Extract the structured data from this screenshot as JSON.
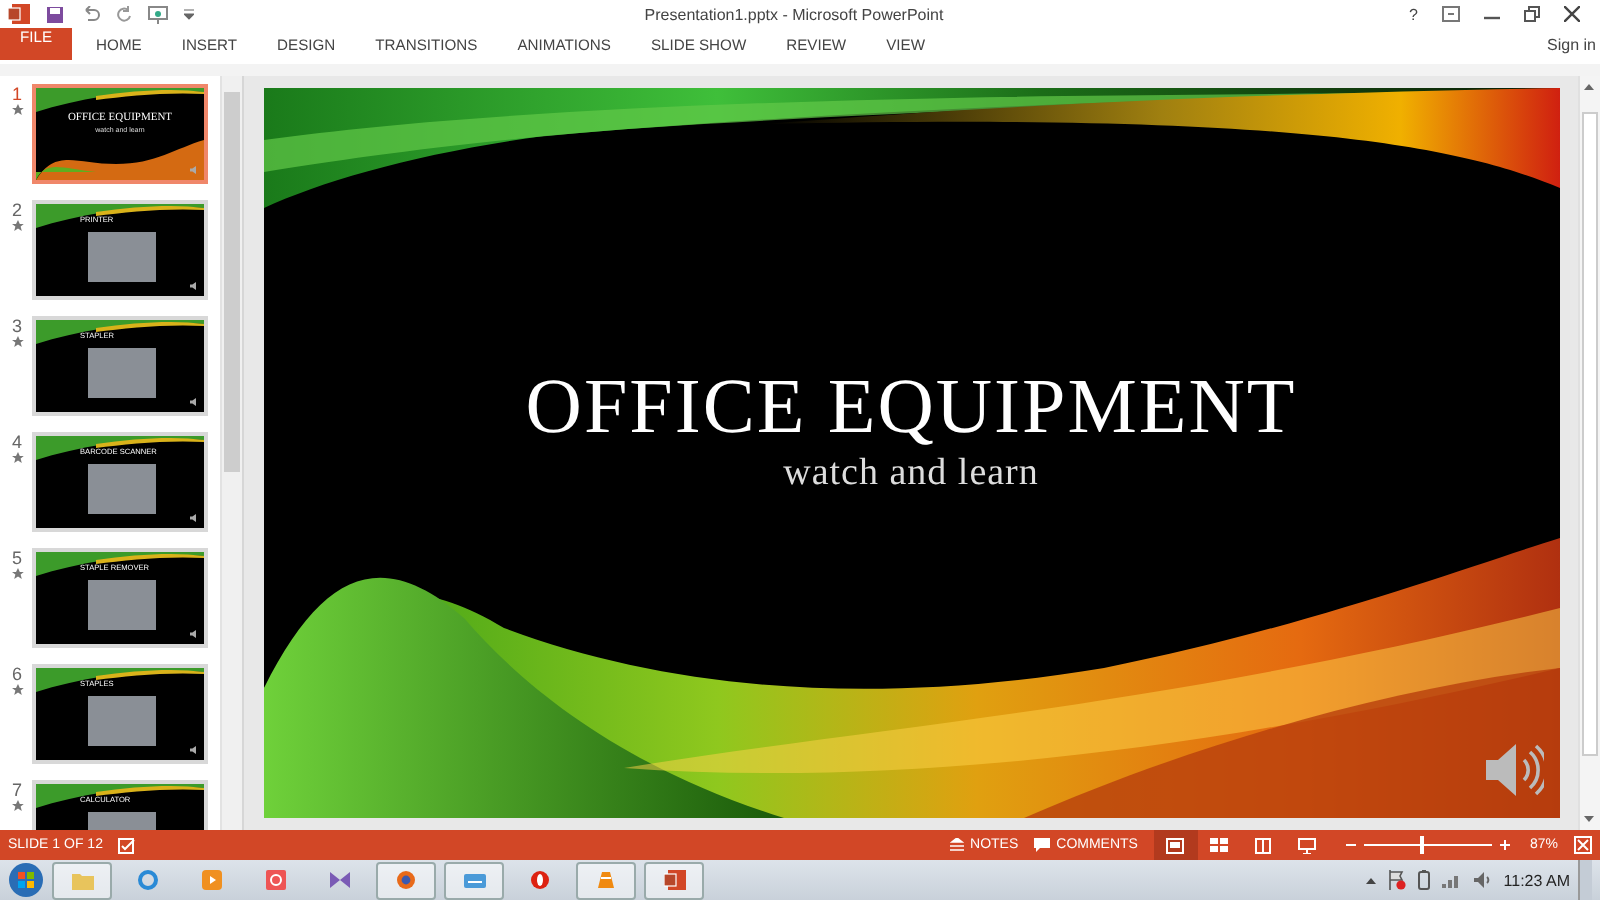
{
  "window": {
    "title": "Presentation1.pptx - Microsoft PowerPoint",
    "help": "?"
  },
  "ribbon": {
    "tabs": [
      {
        "label": "FILE",
        "kind": "file"
      },
      {
        "label": "HOME",
        "kind": "tab"
      },
      {
        "label": "INSERT",
        "kind": "tab"
      },
      {
        "label": "DESIGN",
        "kind": "tab"
      },
      {
        "label": "TRANSITIONS",
        "kind": "tab"
      },
      {
        "label": "ANIMATIONS",
        "kind": "tab"
      },
      {
        "label": "SLIDE SHOW",
        "kind": "tab"
      },
      {
        "label": "REVIEW",
        "kind": "tab"
      },
      {
        "label": "VIEW",
        "kind": "tab"
      }
    ],
    "account": "Sign in"
  },
  "thumbnails": [
    {
      "number": "1",
      "title": "OFFICE EQUIPMENT",
      "subtitle": "watch and learn",
      "kind": "title",
      "selected": true
    },
    {
      "number": "2",
      "title": "PRINTER",
      "kind": "photo",
      "selected": false
    },
    {
      "number": "3",
      "title": "STAPLER",
      "kind": "photo",
      "selected": false
    },
    {
      "number": "4",
      "title": "BARCODE SCANNER",
      "kind": "photo",
      "selected": false
    },
    {
      "number": "5",
      "title": "STAPLE REMOVER",
      "kind": "photo",
      "selected": false
    },
    {
      "number": "6",
      "title": "STAPLES",
      "kind": "photo",
      "selected": false
    },
    {
      "number": "7",
      "title": "CALCULATOR",
      "kind": "photo",
      "selected": false
    }
  ],
  "slide": {
    "title": "OFFICE EQUIPMENT",
    "subtitle": "watch and learn"
  },
  "status_bar": {
    "slide_indicator": "SLIDE 1 OF 12",
    "notes": "NOTES",
    "comments": "COMMENTS",
    "views": [
      {
        "kind": "normal",
        "selected": true
      },
      {
        "kind": "sorter",
        "selected": false
      },
      {
        "kind": "reading",
        "selected": false
      },
      {
        "kind": "show",
        "selected": false
      }
    ],
    "zoom": {
      "level": 0.45,
      "reading": "87%"
    }
  },
  "taskbar": {
    "clock": "11:23 AM"
  }
}
